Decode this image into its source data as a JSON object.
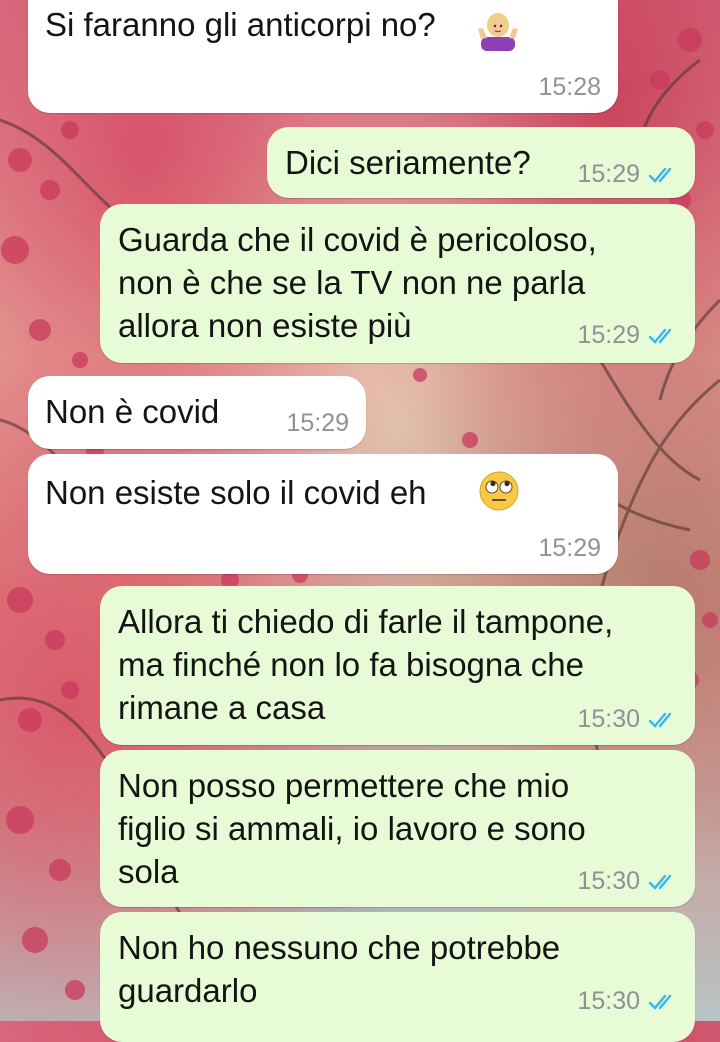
{
  "chat": {
    "messages": [
      {
        "direction": "incoming",
        "text": "Si faranno gli anticorpi no?",
        "emoji": "person-shrugging-emoji",
        "time": "15:28"
      },
      {
        "direction": "outgoing",
        "text": "Dici seriamente?",
        "time": "15:29",
        "status": "read"
      },
      {
        "direction": "outgoing",
        "text": "Guarda che il covid è pericoloso,\nnon è che se la TV non ne parla\nallora non esiste più",
        "time": "15:29",
        "status": "read"
      },
      {
        "direction": "incoming",
        "text": "Non è covid",
        "time": "15:29"
      },
      {
        "direction": "incoming",
        "text": "Non esiste solo il covid eh",
        "emoji": "face-with-rolling-eyes-emoji",
        "time": "15:29"
      },
      {
        "direction": "outgoing",
        "text": "Allora ti chiedo di farle il tampone,\nma finché non lo fa bisogna che\nrimane a casa",
        "time": "15:30",
        "status": "read"
      },
      {
        "direction": "outgoing",
        "text": "Non posso permettere che mio\nfiglio si ammali, io lavoro e sono\nsola",
        "time": "15:30",
        "status": "read"
      },
      {
        "direction": "outgoing",
        "text": "Non ho nessuno che potrebbe\nguardarlo",
        "time": "15:30",
        "status": "read"
      }
    ]
  },
  "colors": {
    "incoming_bubble": "#ffffff",
    "outgoing_bubble": "#e7fbd6",
    "read_ticks": "#34b7f1",
    "timestamp": "#8e9196"
  }
}
